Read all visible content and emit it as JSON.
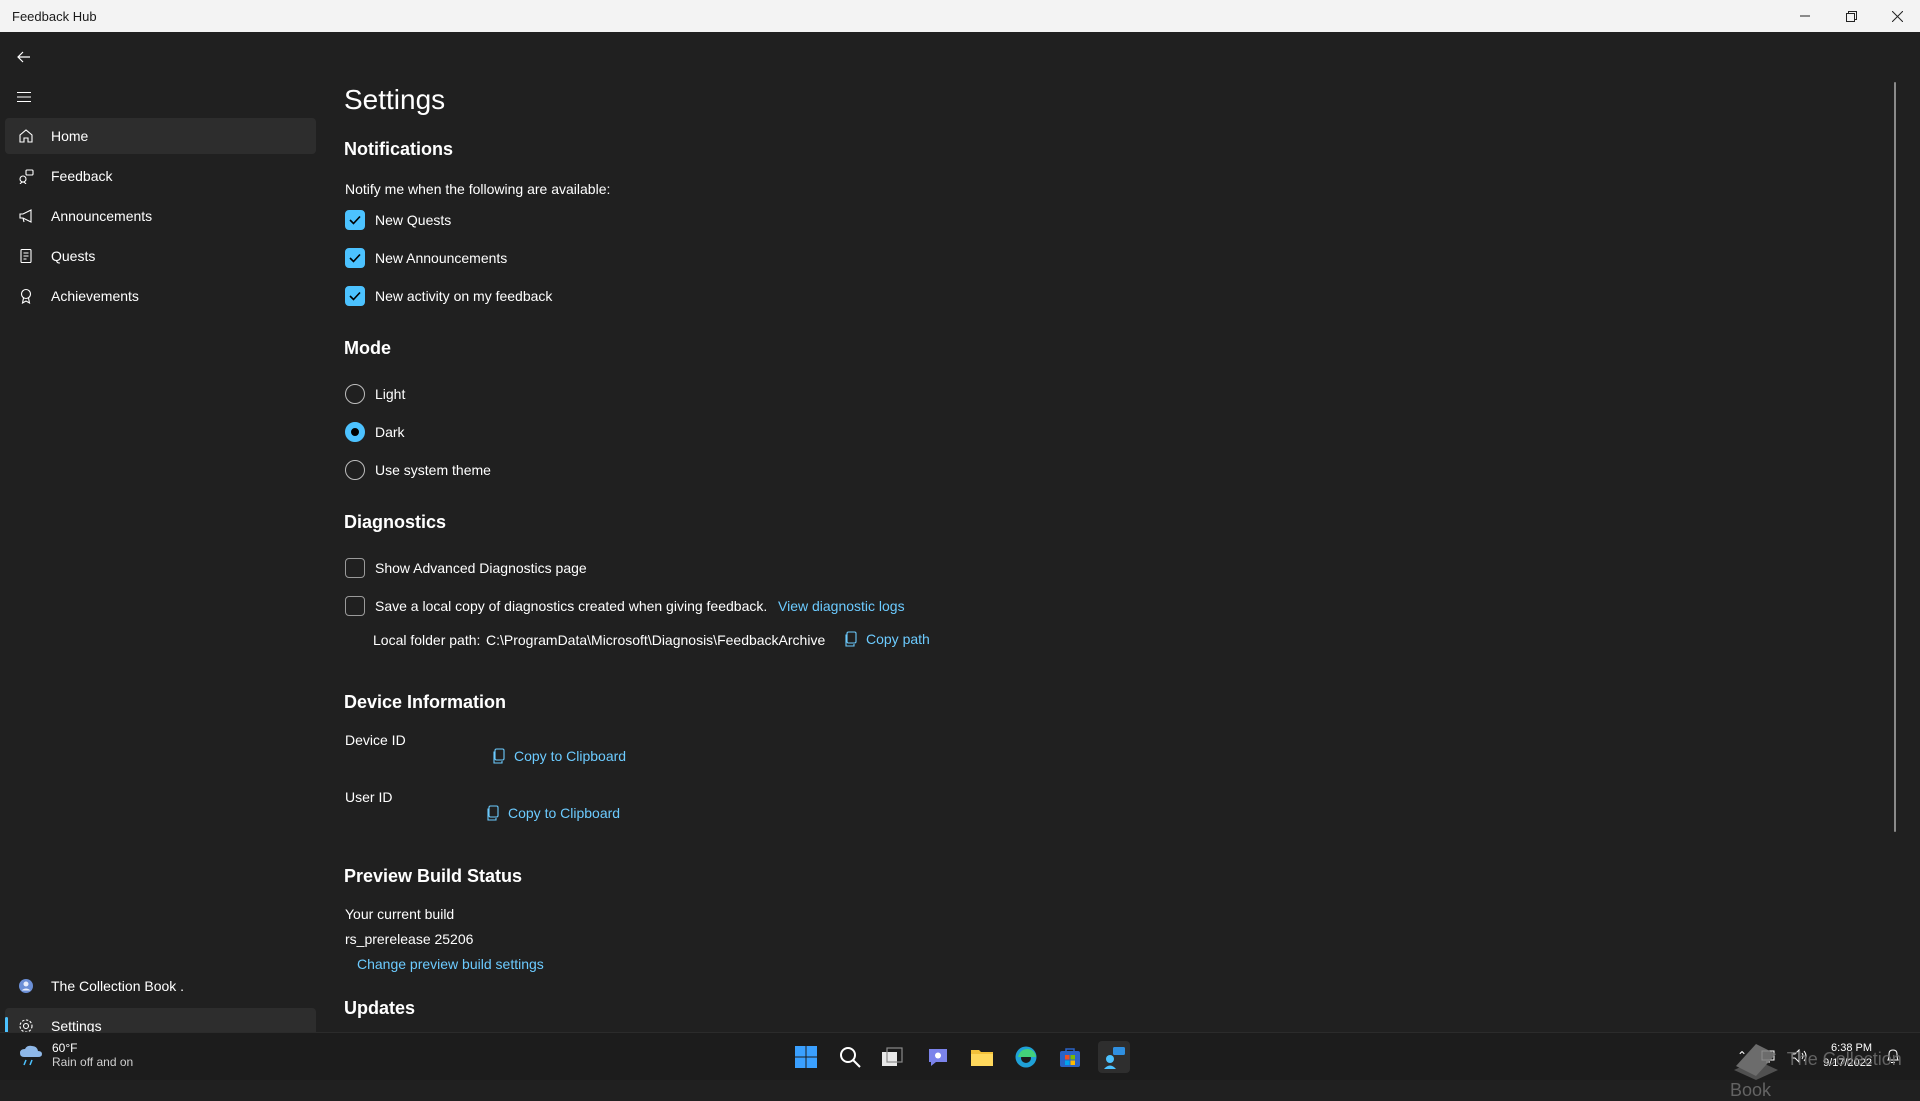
{
  "window": {
    "title": "Feedback Hub"
  },
  "sidebar": {
    "items": [
      {
        "label": "Home"
      },
      {
        "label": "Feedback"
      },
      {
        "label": "Announcements"
      },
      {
        "label": "Quests"
      },
      {
        "label": "Achievements"
      }
    ],
    "account_label": "The Collection Book .",
    "settings_label": "Settings"
  },
  "page": {
    "title": "Settings",
    "notifications": {
      "title": "Notifications",
      "prompt": "Notify me when the following are available:",
      "options": [
        {
          "label": "New Quests",
          "checked": true
        },
        {
          "label": "New Announcements",
          "checked": true
        },
        {
          "label": "New activity on my feedback",
          "checked": true
        }
      ]
    },
    "mode": {
      "title": "Mode",
      "options": [
        {
          "label": "Light",
          "selected": false
        },
        {
          "label": "Dark",
          "selected": true
        },
        {
          "label": "Use system theme",
          "selected": false
        }
      ]
    },
    "diagnostics": {
      "title": "Diagnostics",
      "show_advanced": "Show Advanced Diagnostics page",
      "save_local": "Save a local copy of diagnostics created when giving feedback.",
      "view_logs": "View diagnostic logs",
      "folder_label": "Local folder path:",
      "folder_path": "C:\\ProgramData\\Microsoft\\Diagnosis\\FeedbackArchive",
      "copy_path": "Copy path"
    },
    "device_info": {
      "title": "Device Information",
      "device_id_label": "Device ID",
      "user_id_label": "User ID",
      "copy_label": "Copy to Clipboard"
    },
    "preview_build": {
      "title": "Preview Build Status",
      "current_label": "Your current build",
      "build": "rs_prerelease 25206",
      "change_link": "Change preview build settings"
    },
    "updates": {
      "title": "Updates"
    }
  },
  "taskbar": {
    "weather_temp": "60°F",
    "weather_desc": "Rain off and on",
    "time": "6:38 PM",
    "date": "9/17/2022"
  },
  "watermark": "The Collection Book",
  "colors": {
    "accent": "#4cc2ff",
    "link": "#6ccbff",
    "background": "#202020"
  }
}
